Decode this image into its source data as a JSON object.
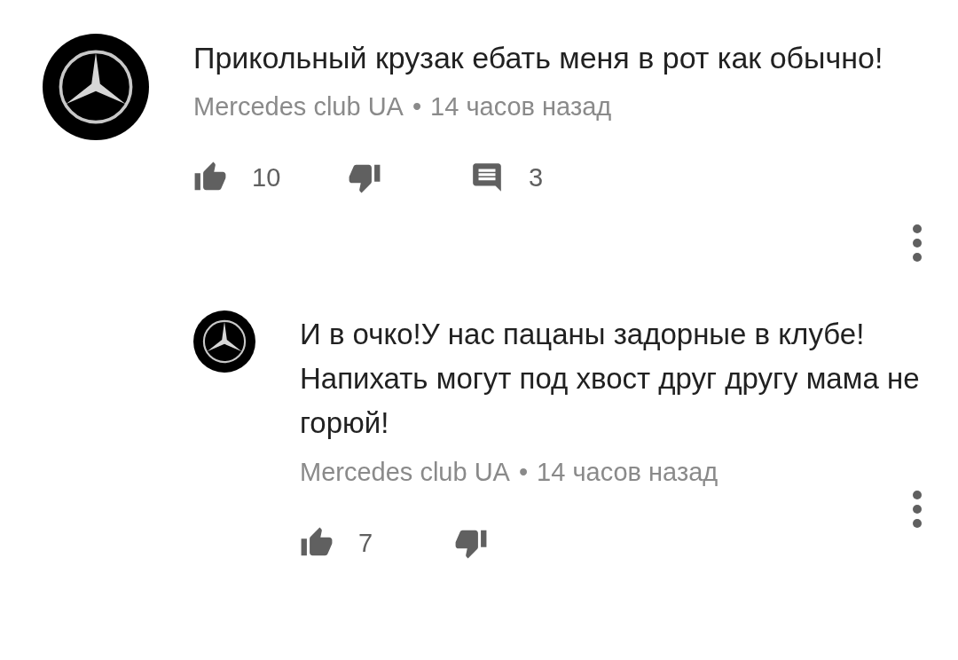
{
  "comments": [
    {
      "kind": "comment",
      "text": "Прикольный крузак ебать меня в рот как обычно!",
      "author": "Mercedes club UA",
      "separator": "•",
      "time": "14 часов назад",
      "likes": "10",
      "replies": "3"
    },
    {
      "kind": "reply",
      "text": "И в очко!У нас пацаны задорные в клубе!Напихать могут под хвост друг другу мама не горюй!",
      "author": "Mercedes club UA",
      "separator": "•",
      "time": "14 часов назад",
      "likes": "7"
    }
  ]
}
